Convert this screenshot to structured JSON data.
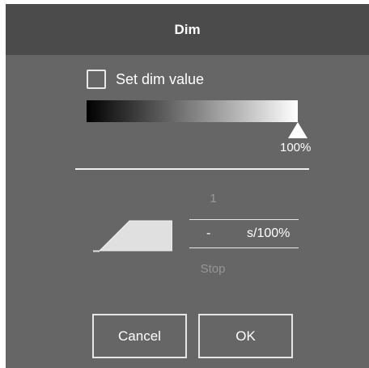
{
  "dialog": {
    "title": "Dim",
    "set_dim_label": "Set dim value",
    "set_dim_checked": false,
    "dim_percent_label": "100%",
    "dim_level": 1.0,
    "fade_value": "1",
    "fade_input_value": "-",
    "fade_unit": "s/100%",
    "stop_label": "Stop",
    "buttons": {
      "cancel": "Cancel",
      "ok": "OK"
    },
    "icons": {
      "ramp": "fade-ramp-icon",
      "slider_handle": "triangle-up-icon"
    },
    "colors": {
      "background": "#666666",
      "titlebar": "#4b4b4b",
      "text": "#ffffff",
      "disabled_text": "#9a9a9a"
    }
  }
}
